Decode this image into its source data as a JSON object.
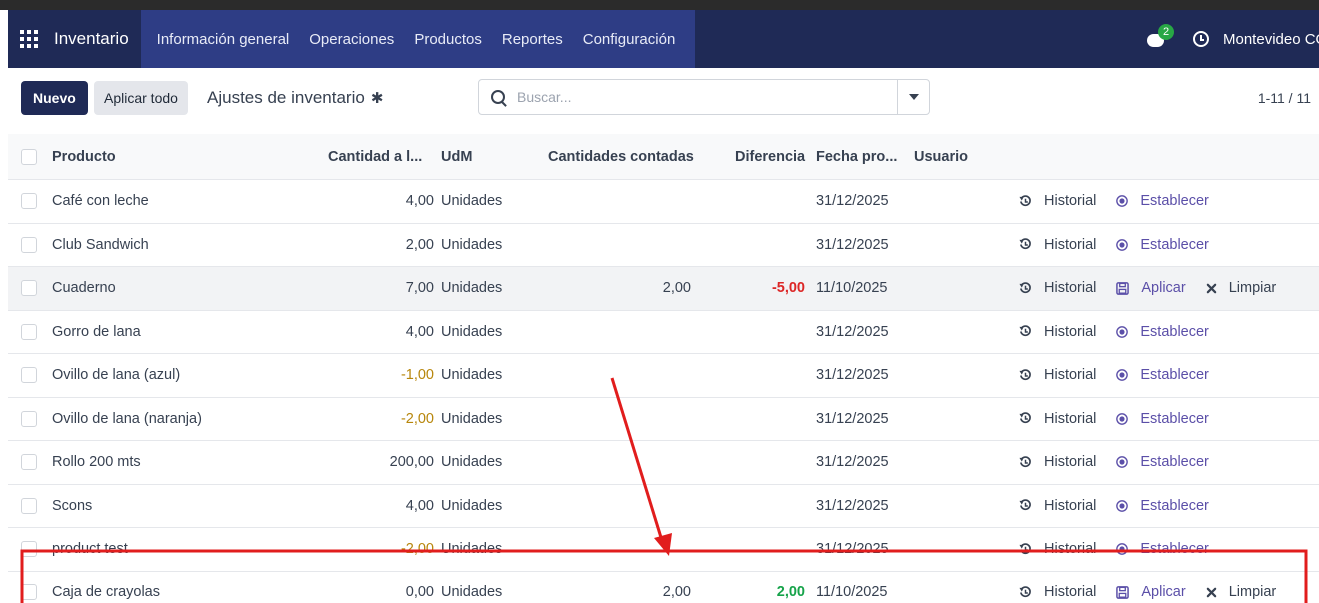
{
  "navbar": {
    "brand": "Inventario",
    "menu": [
      "Información general",
      "Operaciones",
      "Productos",
      "Reportes",
      "Configuración"
    ],
    "chat_badge": "2",
    "company": "Montevideo CO"
  },
  "control": {
    "new_label": "Nuevo",
    "apply_all_label": "Aplicar todo",
    "title": "Ajustes de inventario",
    "search_placeholder": "Buscar...",
    "pager": "1-11 / 11"
  },
  "table": {
    "headers": {
      "product": "Producto",
      "qty": "Cantidad a l...",
      "udm": "UdM",
      "counted": "Cantidades contadas",
      "diff": "Diferencia",
      "date": "Fecha pro...",
      "user": "Usuario"
    },
    "action_labels": {
      "history": "Historial",
      "set": "Establecer",
      "apply": "Aplicar",
      "clear": "Limpiar"
    },
    "rows": [
      {
        "product": "Café con leche",
        "qty": "4,00",
        "udm": "Unidades",
        "counted": "",
        "diff": "",
        "date": "31/12/2025"
      },
      {
        "product": "Club Sandwich",
        "qty": "2,00",
        "udm": "Unidades",
        "counted": "",
        "diff": "",
        "date": "31/12/2025"
      },
      {
        "product": "Cuaderno",
        "qty": "7,00",
        "udm": "Unidades",
        "counted": "2,00",
        "diff": "-5,00",
        "date": "11/10/2025"
      },
      {
        "product": "Gorro de lana",
        "qty": "4,00",
        "udm": "Unidades",
        "counted": "",
        "diff": "",
        "date": "31/12/2025"
      },
      {
        "product": "Ovillo de lana (azul)",
        "qty": "-1,00",
        "udm": "Unidades",
        "counted": "",
        "diff": "",
        "date": "31/12/2025"
      },
      {
        "product": "Ovillo de lana (naranja)",
        "qty": "-2,00",
        "udm": "Unidades",
        "counted": "",
        "diff": "",
        "date": "31/12/2025"
      },
      {
        "product": "Rollo 200 mts",
        "qty": "200,00",
        "udm": "Unidades",
        "counted": "",
        "diff": "",
        "date": "31/12/2025"
      },
      {
        "product": "Scons",
        "qty": "4,00",
        "udm": "Unidades",
        "counted": "",
        "diff": "",
        "date": "31/12/2025"
      },
      {
        "product": "product test",
        "qty": "-2,00",
        "udm": "Unidades",
        "counted": "",
        "diff": "",
        "date": "31/12/2025"
      },
      {
        "product": "Caja de crayolas",
        "qty": "0,00",
        "udm": "Unidades",
        "counted": "2,00",
        "diff": "2,00",
        "date": "11/10/2025"
      }
    ]
  },
  "colors": {
    "navbar": "#1f2a56",
    "menu_bg": "#2e3d85",
    "accent": "#5b4fa8",
    "negative_warning": "#b7860b",
    "negative_diff": "#dc2626",
    "positive_diff": "#16a34a",
    "annotation": "#e11d1d"
  }
}
